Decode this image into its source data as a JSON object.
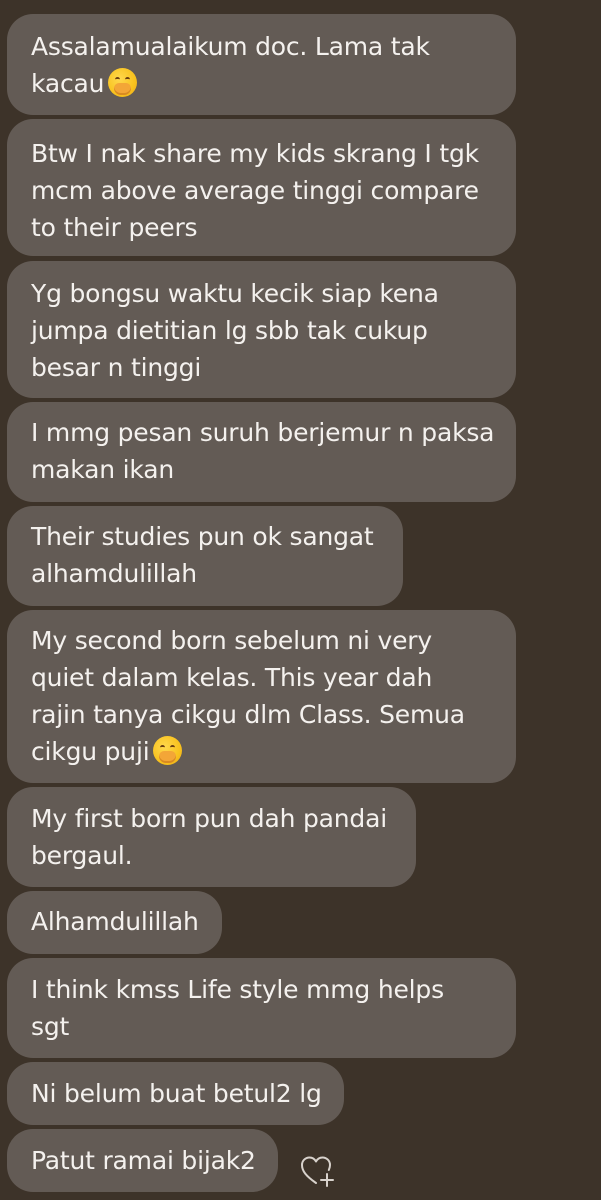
{
  "messages": [
    {
      "lines": [
        "Assalamualaikum doc. Lama tak",
        "kacau"
      ],
      "emoji": "face-with-hand-over-mouth-icon"
    },
    {
      "lines": [
        "Btw I nak share my kids skrang I tgk",
        "mcm above average tinggi compare",
        "to their peers"
      ]
    },
    {
      "lines": [
        "Yg bongsu waktu kecik siap kena",
        "jumpa dietitian lg sbb tak cukup",
        "besar n tinggi"
      ]
    },
    {
      "lines": [
        "I mmg pesan suruh berjemur n paksa",
        "makan ikan"
      ]
    },
    {
      "lines": [
        "Their studies pun ok sangat",
        "alhamdulillah"
      ]
    },
    {
      "lines": [
        "My second born sebelum ni very",
        "quiet dalam kelas. This year dah",
        "rajin tanya cikgu dlm Class. Semua",
        "cikgu puji"
      ],
      "emoji": "face-with-hand-over-mouth-icon"
    },
    {
      "lines": [
        "My first born pun dah pandai",
        "bergaul."
      ]
    },
    {
      "lines": [
        "Alhamdulillah"
      ]
    },
    {
      "lines": [
        "I think kmss Life style mmg helps",
        "sgt"
      ]
    },
    {
      "lines": [
        "Ni belum buat betul2 lg"
      ]
    },
    {
      "lines": [
        "Patut ramai bijak2"
      ]
    }
  ],
  "reaction_button": {
    "icon": "heart-plus-icon"
  },
  "colors": {
    "background": "#3d3329",
    "bubble": "#635b55",
    "text": "#f4f1ee"
  }
}
